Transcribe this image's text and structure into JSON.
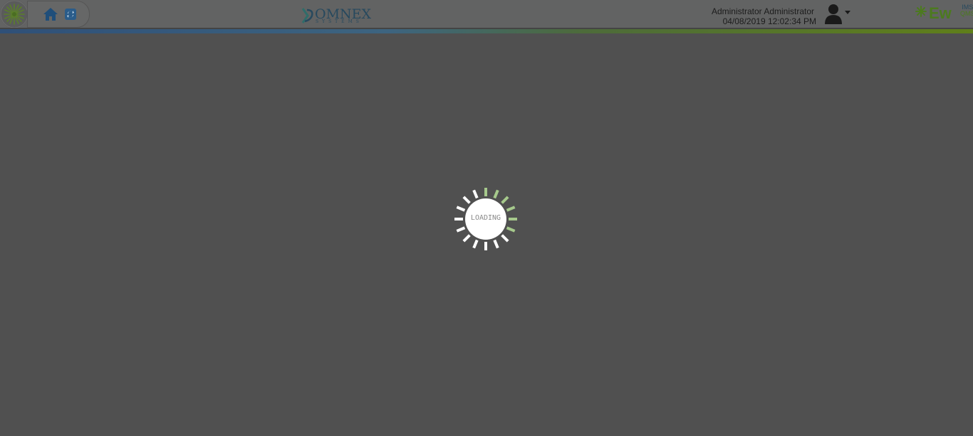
{
  "header": {
    "brand": {
      "name": "OMNEX",
      "tagline": "SYSTEMS"
    },
    "user": {
      "name": "Administrator Administrator",
      "datetime": "04/08/2019 12:02:34 PM"
    },
    "app_logo": {
      "name": "Ew",
      "superscript_top": "IMS",
      "superscript_bottom": "QMS"
    },
    "icons": {
      "logo": "sunburst-logo-icon",
      "home": "home-icon",
      "refresh": "refresh-icon",
      "user": "user-icon",
      "dropdown": "chevron-down-icon"
    }
  },
  "loading": {
    "label": "LOADING"
  },
  "colors": {
    "background": "#505050",
    "header": "#626363",
    "accent_blue": "#2f5078",
    "accent_green": "#5f7f1a",
    "spinner_white": "#ffffff",
    "spinner_green": "#a6c98c"
  }
}
